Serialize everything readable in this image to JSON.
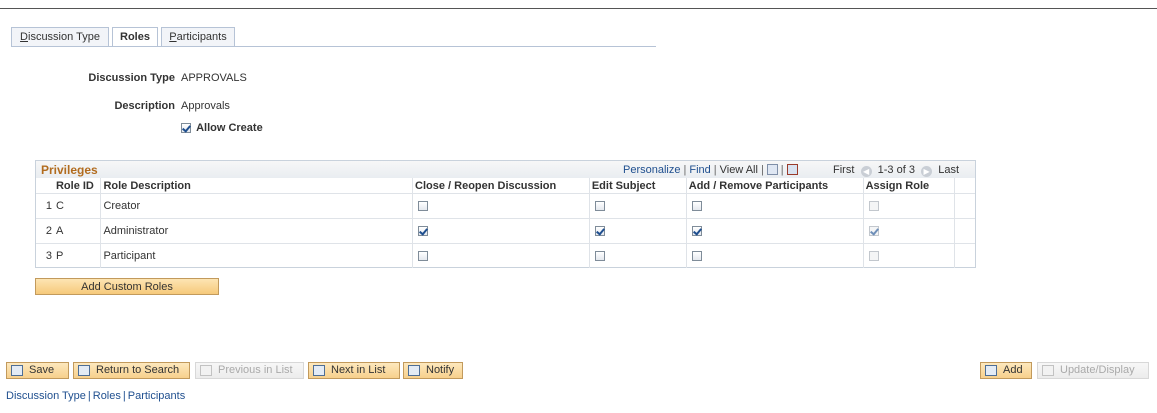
{
  "tabs": [
    {
      "accel": "D",
      "rest": "iscussion Type"
    },
    {
      "label": "Roles"
    },
    {
      "accel": "P",
      "rest": "articipants"
    }
  ],
  "header": {
    "discussion_type_label": "Discussion Type",
    "discussion_type_value": "APPROVALS",
    "description_label": "Description",
    "description_value": "Approvals",
    "allow_create_label": "Allow Create",
    "allow_create_checked": true
  },
  "grid": {
    "title": "Privileges",
    "personalize": "Personalize",
    "find": "Find",
    "view_all": "View All",
    "first": "First",
    "range": "1-3 of 3",
    "last": "Last",
    "columns": [
      "Role ID",
      "Role Description",
      "Close / Reopen Discussion",
      "Edit Subject",
      "Add / Remove Participants",
      "Assign Role"
    ],
    "rows": [
      {
        "num": "1",
        "role_id": "C",
        "desc": "Creator",
        "close": false,
        "edit": false,
        "add": false,
        "assign": false
      },
      {
        "num": "2",
        "role_id": "A",
        "desc": "Administrator",
        "close": true,
        "edit": true,
        "add": true,
        "assign": true
      },
      {
        "num": "3",
        "role_id": "P",
        "desc": "Participant",
        "close": false,
        "edit": false,
        "add": false,
        "assign": false
      }
    ]
  },
  "add_custom_roles": "Add Custom Roles",
  "toolbar": {
    "save": "Save",
    "return_to_search": "Return to Search",
    "previous_in_list": "Previous in List",
    "next_in_list": "Next in List",
    "notify": "Notify",
    "add": "Add",
    "update_display": "Update/Display"
  },
  "footer_links": [
    "Discussion Type",
    "Roles",
    "Participants"
  ]
}
